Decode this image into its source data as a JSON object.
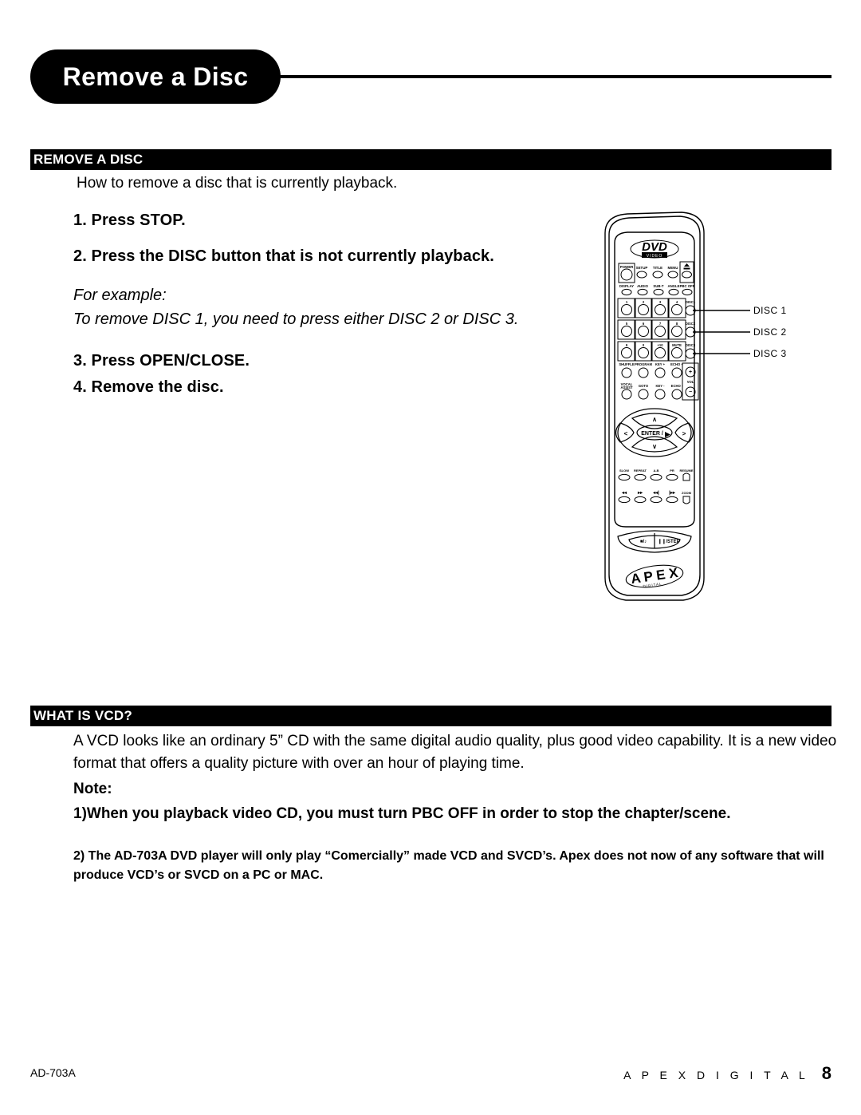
{
  "page": {
    "title": "Remove a Disc"
  },
  "sections": {
    "remove": {
      "bar_label": "REMOVE A DISC",
      "intro": "How to remove a disc that is currently playback.",
      "steps": [
        "1. Press STOP.",
        "2. Press the DISC button that is not currently playback.",
        "3. Press OPEN/CLOSE.",
        "4. Remove the disc."
      ],
      "example_title": "For example:",
      "example_body": "To remove DISC 1, you need to press either DISC 2 or DISC 3."
    },
    "vcd": {
      "bar_label": "WHAT IS VCD?",
      "body": "A VCD looks like an ordinary 5” CD with the same digital audio quality, plus good video capability.  It is a new video format that offers a quality picture with over an hour of playing time.",
      "note_title": "Note:",
      "note_1": "1)When you playback video CD, you must turn PBC OFF in order to stop the chapter/scene.",
      "note_2": "2) The AD-703A DVD player will only play “Comercially” made VCD and SVCD’s. Apex does not now of any software that will produce VCD’s or SVCD on a PC or MAC."
    }
  },
  "remote": {
    "brand_logo": "DVD",
    "brand_logo_sub": "VIDEO",
    "footer_logo": "APEX",
    "footer_logo_sub": "DIGITAL",
    "row_power": [
      "POWER",
      "SETUP",
      "TITLE",
      "MENU"
    ],
    "eject_label": "eject-icon",
    "row_display": [
      "DISPLAY",
      "AUDIO",
      "SUB-T",
      "ANGLE",
      "PBC OFF"
    ],
    "keypad": [
      [
        "1",
        "2",
        "3",
        "4"
      ],
      [
        "5",
        "6",
        "7",
        "8"
      ],
      [
        "9",
        "0",
        "+10",
        "MUTE"
      ]
    ],
    "disc_buttons": [
      "DISC1",
      "DISC2",
      "DISC3"
    ],
    "row_shuffle": [
      "SHUFFLE",
      "PROGRAM",
      "KEY +",
      "ECHO +"
    ],
    "row_vocal": [
      "VOCAL ASSIST",
      "GOTO",
      "KEY -",
      "ECHO -"
    ],
    "vol_label": "VOL",
    "vol_plus": "+",
    "vol_minus": "−",
    "nav": {
      "up": "∧",
      "down": "∨",
      "left": "<",
      "right": ">",
      "center": "ENTER /"
    },
    "row_slow": [
      "SLOW",
      "REPEAT",
      "A-B",
      "PR",
      "RESUME"
    ],
    "row_trans": [
      "◂◂",
      "▸▸",
      "◂◂|",
      "|▸▸",
      "ZOOM"
    ],
    "stop_label": "/",
    "pause_label": "/STEP"
  },
  "callouts": {
    "items": [
      "DISC 1",
      "DISC 2",
      "DISC 3"
    ]
  },
  "footer": {
    "model": "AD-703A",
    "brand": "A P E X   D I G I T A L",
    "page_number": "8"
  }
}
